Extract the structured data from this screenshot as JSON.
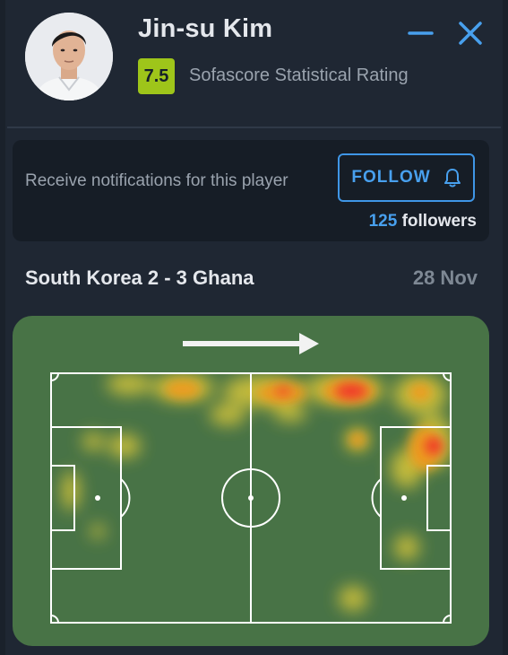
{
  "player": {
    "name": "Jin-su Kim",
    "rating": "7.5",
    "rating_label": "Sofascore Statistical Rating"
  },
  "window_controls": {
    "minimize_icon": "minus-icon",
    "close_icon": "close-icon"
  },
  "notifications": {
    "text": "Receive notifications for this player",
    "follow_label": "FOLLOW",
    "follow_icon": "bell-icon",
    "followers_count": "125",
    "followers_label": "followers"
  },
  "match": {
    "title": "South Korea 2 - 3 Ghana",
    "date": "28 Nov"
  },
  "heatmap": {
    "direction": "attacking-right",
    "colors": {
      "pitch": "#487346",
      "lines": "#ffffff",
      "low": "#d9c73a",
      "mid": "#f29a1c",
      "high": "#f03a2a"
    }
  },
  "colors": {
    "background": "#1f2733",
    "card": "#161d26",
    "accent": "#48a0ee",
    "rating": "#9ec51a",
    "text_primary": "#e4e7ec",
    "text_secondary": "#9aa3ae"
  }
}
